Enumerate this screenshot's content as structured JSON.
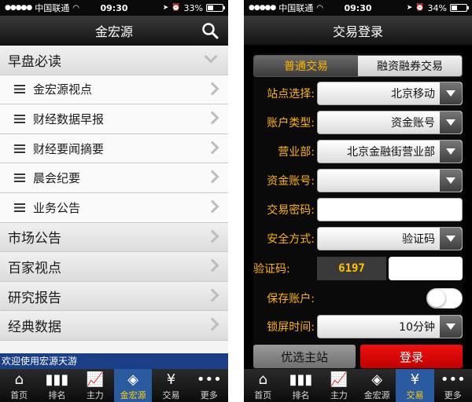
{
  "left": {
    "status": {
      "carrier": "中国联通",
      "time": "09:30",
      "battery": "33%",
      "battery_level": 0.33
    },
    "title": "金宏源",
    "sections": [
      {
        "label": "早盘必读",
        "expanded": true,
        "items": [
          "金宏源视点",
          "财经数据早报",
          "财经要闻摘要",
          "晨会纪要",
          "业务公告"
        ]
      },
      {
        "label": "市场公告"
      },
      {
        "label": "百家视点"
      },
      {
        "label": "研究报告"
      },
      {
        "label": "经典数据"
      }
    ],
    "marquee": "欢迎使用宏源天游",
    "tabs": [
      {
        "label": "首页",
        "icon": "home-icon"
      },
      {
        "label": "排名",
        "icon": "bar-chart-icon"
      },
      {
        "label": "主力",
        "icon": "trend-icon"
      },
      {
        "label": "金宏源",
        "icon": "logo-icon",
        "active": true
      },
      {
        "label": "交易",
        "icon": "yen-icon"
      },
      {
        "label": "更多",
        "icon": "more-icon"
      }
    ]
  },
  "right": {
    "status": {
      "carrier": "中国联通",
      "time": "09:30",
      "battery": "34%",
      "battery_level": 0.34
    },
    "title": "交易登录",
    "segments": [
      "普通交易",
      "融资融券交易"
    ],
    "fields": {
      "station_label": "站点选择:",
      "station_value": "北京移动",
      "account_type_label": "账户类型:",
      "account_type_value": "资金账号",
      "branch_label": "营业部:",
      "branch_value": "北京金融街营业部",
      "account_label": "资金账号:",
      "account_value": "",
      "password_label": "交易密码:",
      "password_value": "",
      "security_label": "安全方式:",
      "security_value": "验证码",
      "captcha_label": "验证码:",
      "captcha_code": "6197",
      "save_label": "保存账户:",
      "save_on": false,
      "lock_label": "锁屏时间:",
      "lock_value": "10分钟"
    },
    "buttons": {
      "preferred": "优选主站",
      "login": "登录"
    },
    "tabs": [
      {
        "label": "首页",
        "icon": "home-icon"
      },
      {
        "label": "排名",
        "icon": "bar-chart-icon"
      },
      {
        "label": "主力",
        "icon": "trend-icon"
      },
      {
        "label": "金宏源",
        "icon": "logo-icon"
      },
      {
        "label": "交易",
        "icon": "yen-icon",
        "active": true
      },
      {
        "label": "更多",
        "icon": "more-icon"
      }
    ]
  }
}
